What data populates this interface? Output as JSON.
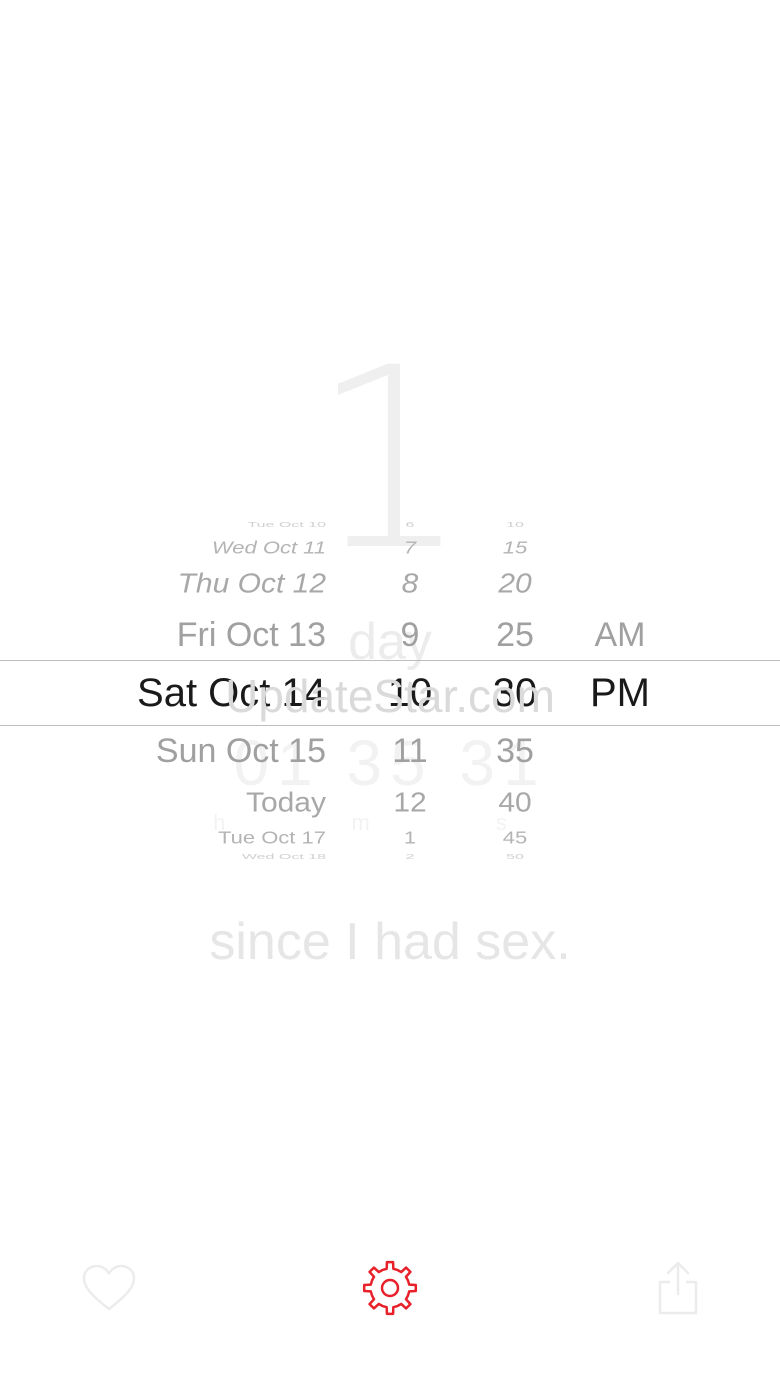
{
  "background": {
    "count": "1",
    "unit": "day",
    "time": "01 35 31",
    "time_labels": "h m s",
    "caption": "since I had sex."
  },
  "watermark": "UpdateStar.com",
  "picker": {
    "dates": [
      "Tue Oct 10",
      "Wed Oct 11",
      "Thu Oct 12",
      "Fri Oct 13",
      "Sat Oct 14",
      "Sun Oct 15",
      "Today",
      "Tue Oct 17",
      "Wed Oct 18"
    ],
    "hours": [
      "6",
      "7",
      "8",
      "9",
      "10",
      "11",
      "12",
      "1",
      "2"
    ],
    "minutes": [
      "10",
      "15",
      "20",
      "25",
      "30",
      "35",
      "40",
      "45",
      "50"
    ],
    "ampm": [
      "AM",
      "PM"
    ],
    "selected": {
      "date": "Sat Oct 14",
      "hour": "10",
      "minute": "30",
      "ampm": "PM"
    }
  },
  "tabbar": {
    "icons": [
      "heart-icon",
      "gear-icon",
      "share-icon"
    ],
    "accent": "#e8202a"
  }
}
